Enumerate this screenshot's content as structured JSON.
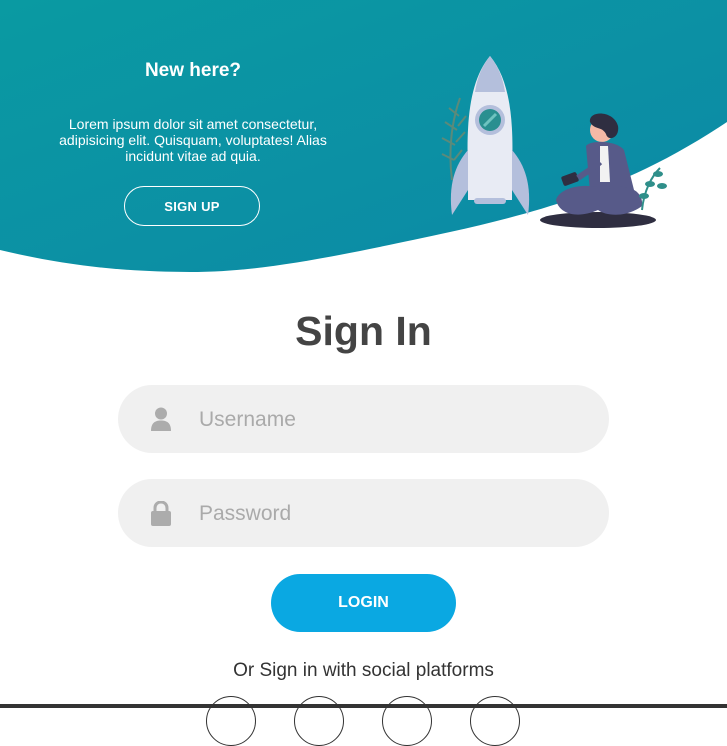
{
  "panel": {
    "title": "New here?",
    "text": "Lorem ipsum dolor sit amet consectetur, adipisicing elit. Quisquam, voluptates! Alias incidunt vitae ad quia.",
    "signup_label": "SIGN UP"
  },
  "signin": {
    "title": "Sign In",
    "username_placeholder": "Username",
    "password_placeholder": "Password",
    "login_label": "LOGIN",
    "social_text": "Or Sign in with social platforms"
  },
  "icons": {
    "user": "user-icon",
    "lock": "lock-icon"
  },
  "colors": {
    "panel_gradient_start": "#0a99a3",
    "panel_gradient_end": "#0d89a6",
    "login_button": "#0aa8e2",
    "input_bg": "#f0f0f0",
    "title_text": "#444444"
  }
}
